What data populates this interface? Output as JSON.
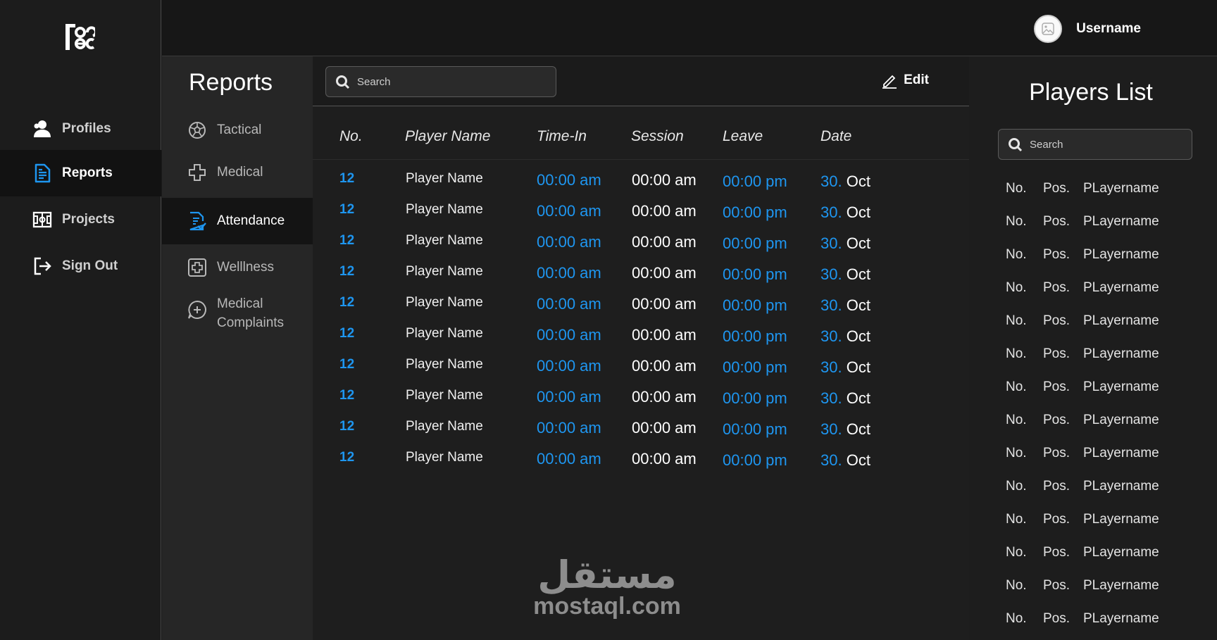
{
  "user": {
    "name": "Username"
  },
  "nav": {
    "items": [
      {
        "label": "Profiles",
        "icon": "user-icon",
        "active": false
      },
      {
        "label": "Reports",
        "icon": "document-icon",
        "active": true
      },
      {
        "label": "Projects",
        "icon": "field-icon",
        "active": false
      },
      {
        "label": "Sign Out",
        "icon": "sign-out-icon",
        "active": false
      }
    ]
  },
  "reports": {
    "title": "Reports",
    "items": [
      {
        "label": "Tactical",
        "icon": "soccer-ball-icon"
      },
      {
        "label": "Medical",
        "icon": "medical-cross-icon"
      },
      {
        "label": "Attendance",
        "icon": "attendance-document-icon",
        "active": true
      },
      {
        "label": "Welllness",
        "icon": "first-aid-icon"
      },
      {
        "label": "Medical\nComplaints",
        "icon": "chat-plus-icon"
      }
    ]
  },
  "main": {
    "search_placeholder": "Search",
    "edit_label": "Edit",
    "columns": [
      "No.",
      "Player Name",
      "Time-In",
      "Session",
      "Leave",
      "Date"
    ],
    "rows": [
      {
        "no": "12",
        "name": "Player Name",
        "time_in": "00:00 am",
        "session": "00:00 am",
        "leave": "00:00 pm",
        "day": "30.",
        "month": "Oct"
      },
      {
        "no": "12",
        "name": "Player Name",
        "time_in": "00:00 am",
        "session": "00:00 am",
        "leave": "00:00 pm",
        "day": "30.",
        "month": "Oct"
      },
      {
        "no": "12",
        "name": "Player Name",
        "time_in": "00:00 am",
        "session": "00:00 am",
        "leave": "00:00 pm",
        "day": "30.",
        "month": "Oct"
      },
      {
        "no": "12",
        "name": "Player Name",
        "time_in": "00:00 am",
        "session": "00:00 am",
        "leave": "00:00 pm",
        "day": "30.",
        "month": "Oct"
      },
      {
        "no": "12",
        "name": "Player Name",
        "time_in": "00:00 am",
        "session": "00:00 am",
        "leave": "00:00 pm",
        "day": "30.",
        "month": "Oct"
      },
      {
        "no": "12",
        "name": "Player Name",
        "time_in": "00:00 am",
        "session": "00:00 am",
        "leave": "00:00 pm",
        "day": "30.",
        "month": "Oct"
      },
      {
        "no": "12",
        "name": "Player Name",
        "time_in": "00:00 am",
        "session": "00:00 am",
        "leave": "00:00 pm",
        "day": "30.",
        "month": "Oct"
      },
      {
        "no": "12",
        "name": "Player Name",
        "time_in": "00:00 am",
        "session": "00:00 am",
        "leave": "00:00 pm",
        "day": "30.",
        "month": "Oct"
      },
      {
        "no": "12",
        "name": "Player Name",
        "time_in": "00:00 am",
        "session": "00:00 am",
        "leave": "00:00 pm",
        "day": "30.",
        "month": "Oct"
      },
      {
        "no": "12",
        "name": "Player Name",
        "time_in": "00:00 am",
        "session": "00:00 am",
        "leave": "00:00 pm",
        "day": "30.",
        "month": "Oct"
      }
    ]
  },
  "players": {
    "title": "Players List",
    "search_placeholder": "Search",
    "items": [
      {
        "no": "No.",
        "pos": "Pos.",
        "name": "PLayername"
      },
      {
        "no": "No.",
        "pos": "Pos.",
        "name": "PLayername"
      },
      {
        "no": "No.",
        "pos": "Pos.",
        "name": "PLayername"
      },
      {
        "no": "No.",
        "pos": "Pos.",
        "name": "PLayername"
      },
      {
        "no": "No.",
        "pos": "Pos.",
        "name": "PLayername"
      },
      {
        "no": "No.",
        "pos": "Pos.",
        "name": "PLayername"
      },
      {
        "no": "No.",
        "pos": "Pos.",
        "name": "PLayername"
      },
      {
        "no": "No.",
        "pos": "Pos.",
        "name": "PLayername"
      },
      {
        "no": "No.",
        "pos": "Pos.",
        "name": "PLayername"
      },
      {
        "no": "No.",
        "pos": "Pos.",
        "name": "PLayername"
      },
      {
        "no": "No.",
        "pos": "Pos.",
        "name": "PLayername"
      },
      {
        "no": "No.",
        "pos": "Pos.",
        "name": "PLayername"
      },
      {
        "no": "No.",
        "pos": "Pos.",
        "name": "PLayername"
      },
      {
        "no": "No.",
        "pos": "Pos.",
        "name": "PLayername"
      }
    ]
  },
  "watermark": {
    "arabic": "مستقل",
    "latin": "mostaql.com"
  },
  "colors": {
    "accent": "#1e96f0",
    "background": "#1a1a1a"
  }
}
